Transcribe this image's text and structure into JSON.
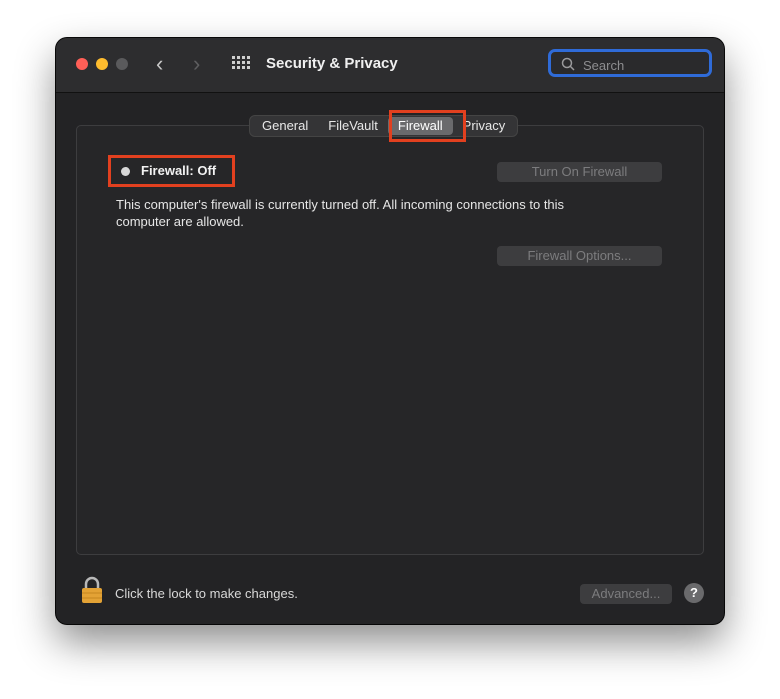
{
  "window": {
    "title": "Security & Privacy",
    "search": {
      "placeholder": "Search",
      "value": ""
    }
  },
  "tabs": [
    {
      "label": "General"
    },
    {
      "label": "FileVault"
    },
    {
      "label": "Firewall",
      "active": true
    },
    {
      "label": "Privacy"
    }
  ],
  "firewall": {
    "status_label": "Firewall: Off",
    "description": "This computer's firewall is currently turned off. All incoming connections to this computer are allowed.",
    "turn_on_label": "Turn On Firewall",
    "options_label": "Firewall Options..."
  },
  "footer": {
    "lock_text": "Click the lock to make changes.",
    "advanced_label": "Advanced...",
    "help_label": "?"
  },
  "colors": {
    "highlight": "#e2401f",
    "search_focus": "#2f6bd8",
    "window_bg": "#232325"
  }
}
